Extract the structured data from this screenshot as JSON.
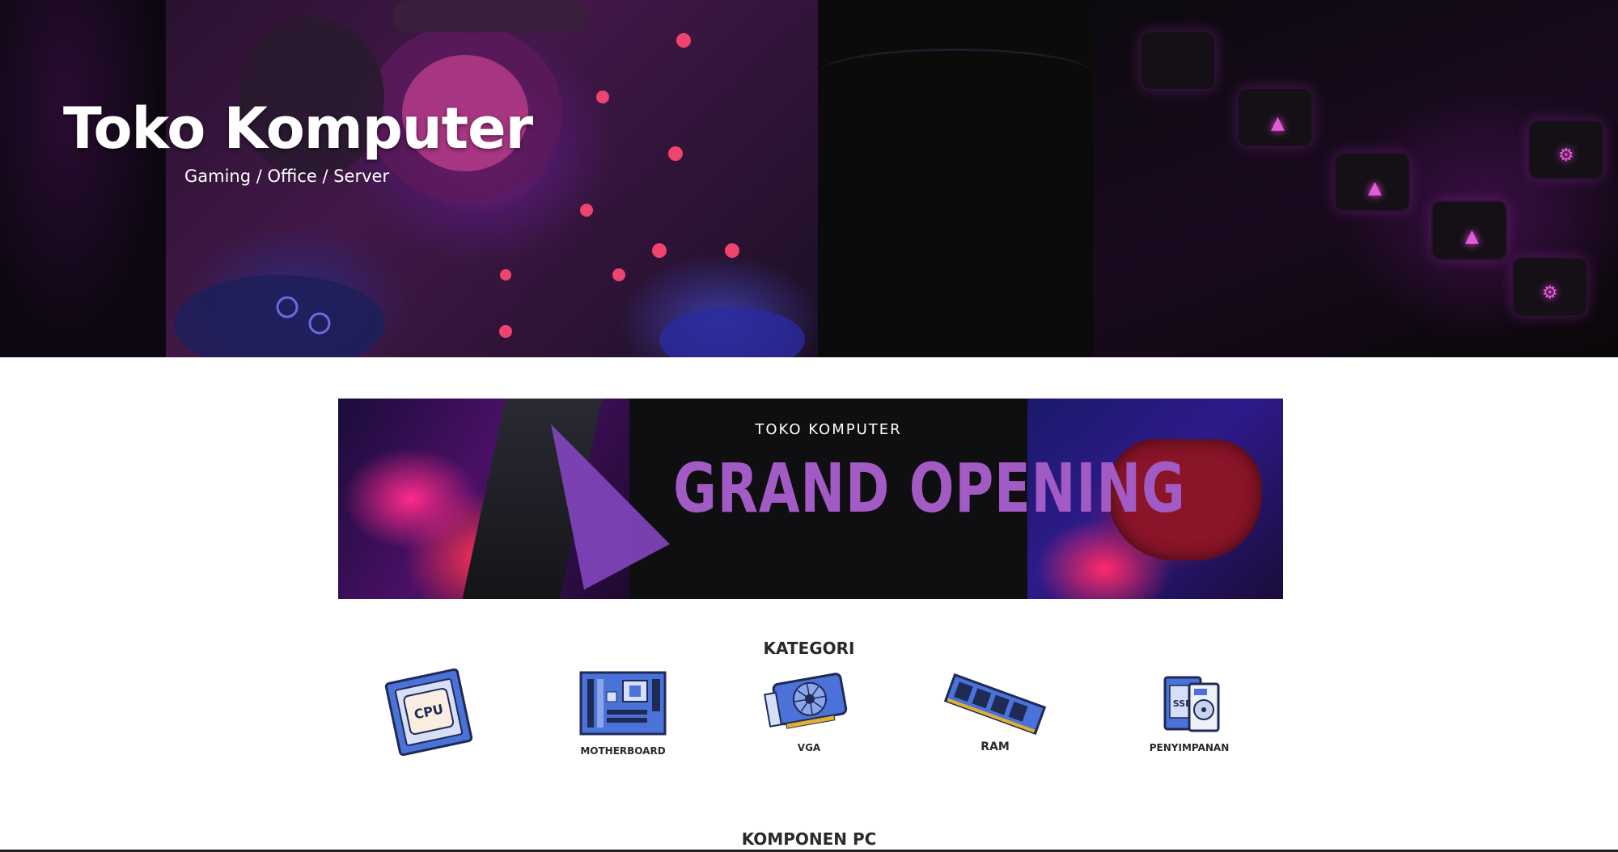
{
  "site": {
    "title": "Toko Komputer",
    "tagline": "Gaming / Office / Server"
  },
  "banner": {
    "kicker": "TOKO KOMPUTER",
    "headline": "GRAND OPENING"
  },
  "categories": {
    "heading": "KATEGORI",
    "items": [
      {
        "icon": "cpu-icon",
        "label": "",
        "chip_text": "CPU"
      },
      {
        "icon": "motherboard-icon",
        "label": "MOTHERBOARD"
      },
      {
        "icon": "vga-icon",
        "label": "VGA"
      },
      {
        "icon": "ram-icon",
        "label": "RAM"
      },
      {
        "icon": "storage-icon",
        "label": "PENYIMPANAN",
        "chip_text": "SSD"
      }
    ]
  },
  "components": {
    "heading": "KOMPONEN PC"
  },
  "colors": {
    "accent_purple": "#a25bc4",
    "icon_blue": "#4a72d9",
    "hero_background": "#07070a"
  }
}
